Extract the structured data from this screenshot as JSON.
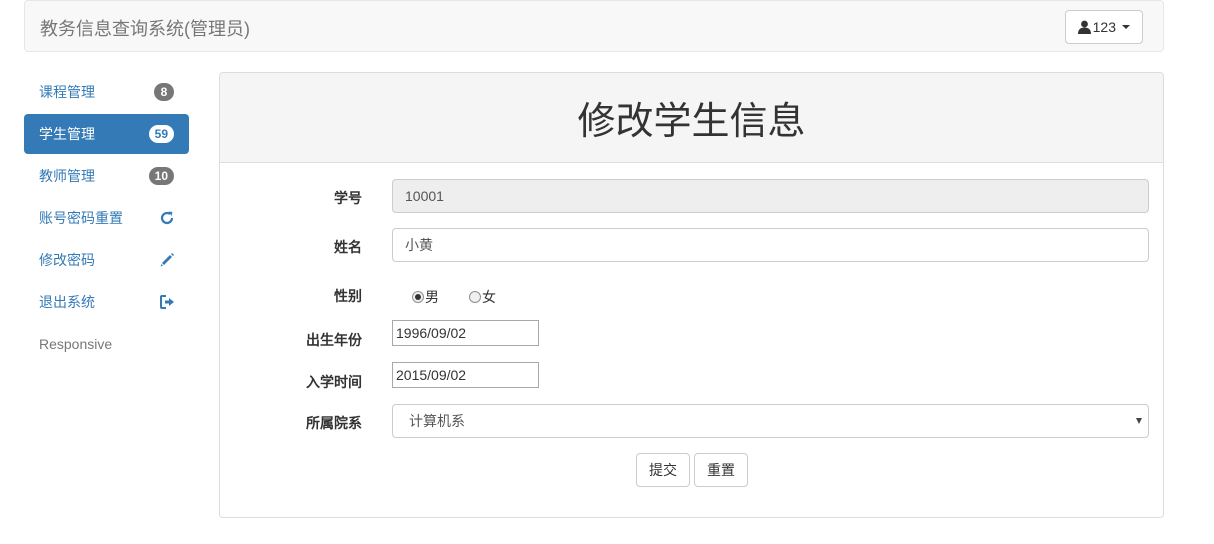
{
  "navbar": {
    "brand": "教务信息查询系统(管理员)",
    "user_label": "123"
  },
  "sidebar": {
    "items": [
      {
        "label": "课程管理",
        "badge": "8"
      },
      {
        "label": "学生管理",
        "badge": "59"
      },
      {
        "label": "教师管理",
        "badge": "10"
      },
      {
        "label": "账号密码重置",
        "icon": "refresh-icon"
      },
      {
        "label": "修改密码",
        "icon": "pencil-icon"
      },
      {
        "label": "退出系统",
        "icon": "logout-icon"
      },
      {
        "label": "Responsive"
      }
    ]
  },
  "form": {
    "title": "修改学生信息",
    "student_id": {
      "label": "学号",
      "value": "10001"
    },
    "name": {
      "label": "姓名",
      "value": "小黄"
    },
    "gender": {
      "label": "性别",
      "options": [
        "男",
        "女"
      ],
      "selected": "男"
    },
    "birth": {
      "label": "出生年份",
      "value": "1996/09/02"
    },
    "enroll": {
      "label": "入学时间",
      "value": "2015/09/02"
    },
    "department": {
      "label": "所属院系",
      "value": "计算机系"
    },
    "submit_label": "提交",
    "reset_label": "重置"
  },
  "colors": {
    "primary": "#337ab7",
    "badge": "#777777"
  }
}
